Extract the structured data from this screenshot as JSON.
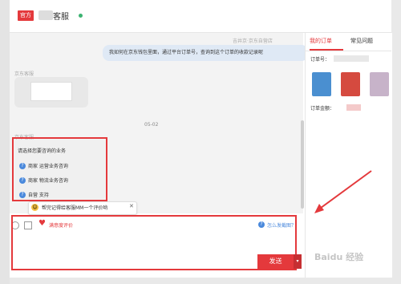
{
  "header": {
    "badge": "官方",
    "title": "客服"
  },
  "chat": {
    "sender_meta": "吉井京·京东自营店",
    "user_message": "我如何在京东钱包里面，通过平台订单号，查询到这个订单的收款记录呢",
    "agent_meta": "京东客服",
    "date": "05-02",
    "agent_meta2": "京东客服",
    "menu": {
      "title": "请选择您要咨询的业务",
      "items": [
        {
          "label": "商家 运营业务咨询"
        },
        {
          "label": "商家 物流业务咨询"
        },
        {
          "label": "自营 支持"
        }
      ]
    },
    "review_prompt": "帮完记得给客服MM一个评价哟"
  },
  "toolbar": {
    "evaluate": "满意度评价",
    "help": "怎么发截图？"
  },
  "input": {
    "send": "发送"
  },
  "right": {
    "tabs": [
      "我的订单",
      "常见问题"
    ],
    "order_number_label": "订单号：",
    "order_amount_label": "订单金额："
  },
  "watermark": "Baidu 经验"
}
